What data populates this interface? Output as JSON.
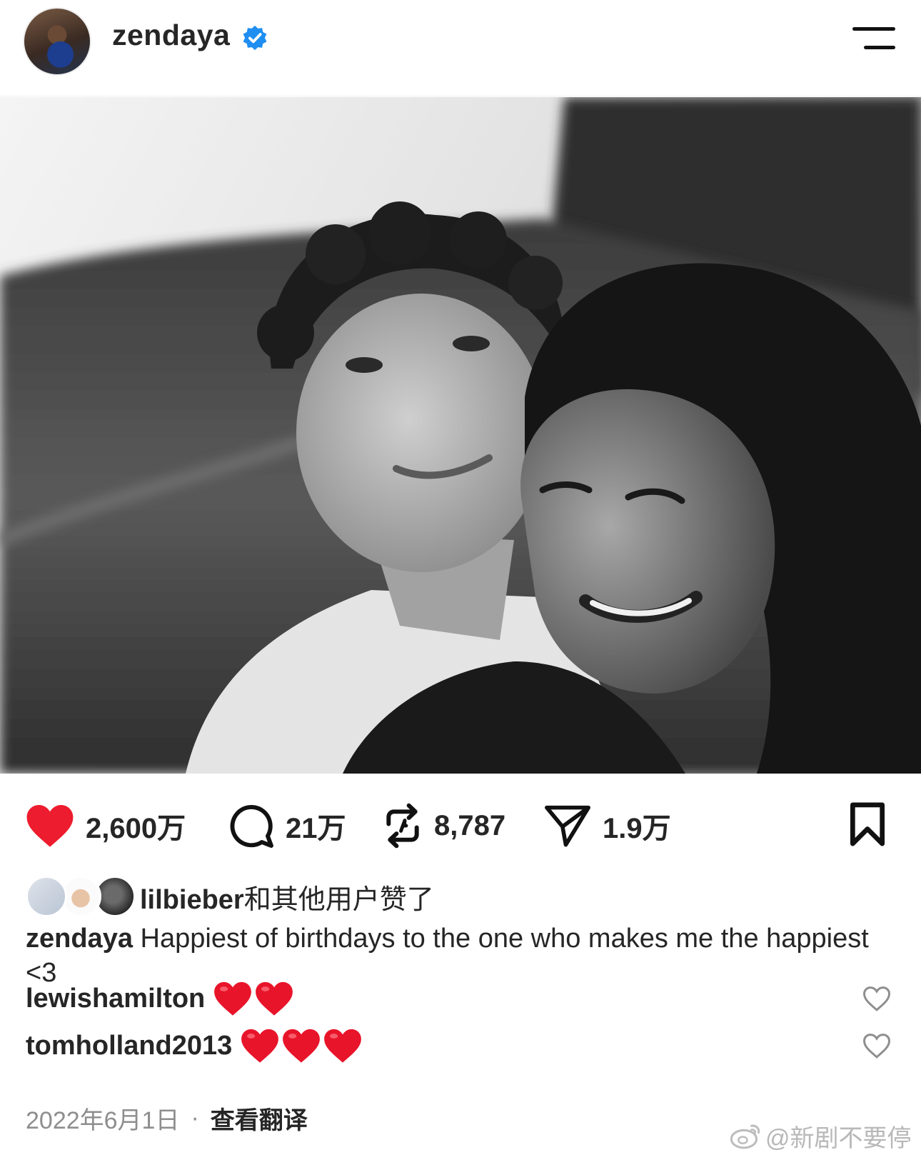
{
  "header": {
    "username": "zendaya",
    "verified_icon": "verified-badge-icon",
    "menu_icon": "menu-icon"
  },
  "post": {
    "image_icon": "photo"
  },
  "actions": {
    "likes_count": "2,600万",
    "comments_count": "21万",
    "reposts_count": "8,787",
    "shares_count": "1.9万",
    "colors": {
      "like": "#ed1c2e",
      "verified": "#1f8ef1"
    }
  },
  "liked_by": {
    "user": "lilbieber",
    "suffix": "和其他用户赞了"
  },
  "caption": {
    "user": "zendaya",
    "text": "Happiest of birthdays to the one who makes me the happiest <3"
  },
  "comments": [
    {
      "user": "lewishamilton",
      "hearts": 2
    },
    {
      "user": "tomholland2013",
      "hearts": 3
    }
  ],
  "footer": {
    "date": "2022年6月1日",
    "separator": "·",
    "translate": "查看翻译"
  },
  "watermark": "@新剧不要停"
}
